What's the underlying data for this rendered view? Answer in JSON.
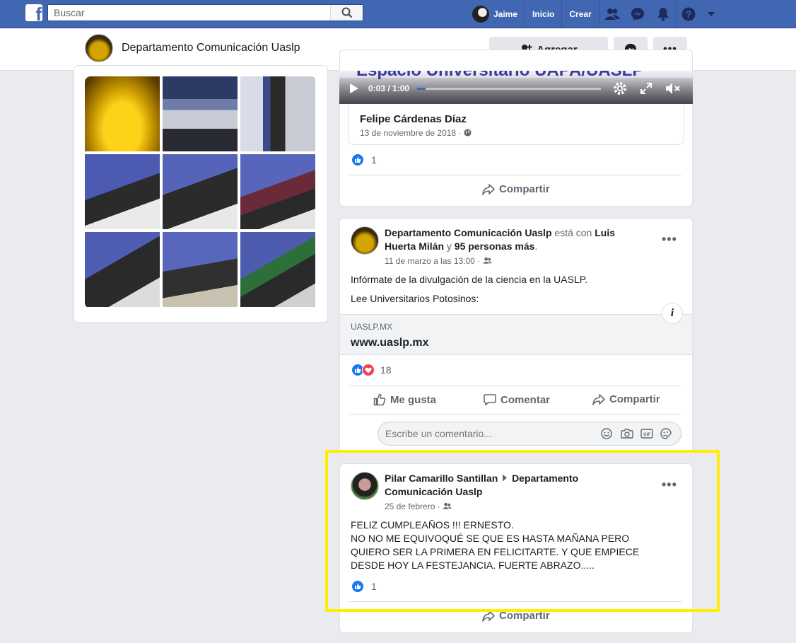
{
  "topbar": {
    "search_placeholder": "Buscar",
    "user_name": "Jaime",
    "home_label": "Inicio",
    "create_label": "Crear"
  },
  "page": {
    "name": "Departamento Comunicación Uaslp",
    "add_label": "Agregar"
  },
  "video_post": {
    "time": "0:03 / 1:00",
    "caption_title": "Espacio Universitario UAPA/UASLP",
    "shared_author": "Felipe Cárdenas Díaz",
    "shared_date": "13 de noviembre de 2018",
    "reactions_count": "1",
    "share_label": "Compartir"
  },
  "link_post": {
    "author": "Departamento Comunicación Uaslp",
    "with_text": "está con",
    "tagged": "Luis Huerta Milán",
    "and_text": "y",
    "others": "95 personas más",
    "date": "11 de marzo a las 13:00",
    "text_line1": "Infórmate de la divulgación de la ciencia en la UASLP.",
    "text_line2": "Lee Universitarios Potosinos:",
    "link_domain": "UASLP.MX",
    "link_title": "www.uaslp.mx",
    "reactions_count": "18",
    "like_label": "Me gusta",
    "comment_label": "Comentar",
    "share_label": "Compartir",
    "comment_placeholder": "Escribe un comentario..."
  },
  "birthday_post": {
    "author": "Pilar Camarillo Santillan",
    "target": "Departamento Comunicación Uaslp",
    "date": "25 de febrero",
    "text_line1": "FELIZ CUMPLEAÑOS !!!  ERNESTO.",
    "text_line2": "NO NO ME EQUIVOQUÉ SE QUE ES HASTA MAÑANA PERO",
    "text_line3": "QUIERO SER LA PRIMERA EN FELICITARTE. Y QUE EMPIECE",
    "text_line4": "DESDE HOY LA FESTEJANCIA. FUERTE ABRAZO.....",
    "reactions_count": "1",
    "share_label": "Compartir"
  },
  "colors": {
    "brand": "#4267b2",
    "like": "#1877f2",
    "love": "#f33e58",
    "highlight": "#ffee00"
  }
}
